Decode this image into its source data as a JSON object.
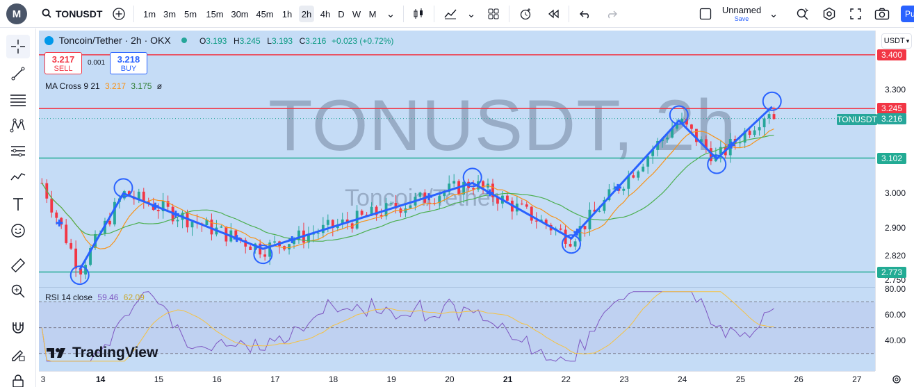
{
  "toolbar": {
    "symbol": "TONUSDT",
    "intervals": [
      "1m",
      "3m",
      "5m",
      "15m",
      "30m",
      "45m",
      "1h",
      "2h",
      "4h",
      "D",
      "W",
      "M"
    ],
    "active_interval": "2h",
    "layout_name": "Unnamed",
    "layout_status": "Save",
    "publish_label": "Pu"
  },
  "legend": {
    "title": "Toncoin/Tether · 2h · OKX",
    "open_label": "O",
    "open": "3.193",
    "high_label": "H",
    "high": "3.245",
    "low_label": "L",
    "low": "3.193",
    "close_label": "C",
    "close": "3.216",
    "change": "+0.023 (+0.72%)",
    "sell_price": "3.217",
    "sell_label": "SELL",
    "spread": "0.001",
    "buy_price": "3.218",
    "buy_label": "BUY",
    "ma_label": "MA Cross 9 21",
    "ma_fast": "3.217",
    "ma_slow": "3.175",
    "ma_symbol": "ø",
    "rsi_label": "RSI 14 close",
    "rsi_value": "59.46",
    "rsi_ma": "62.09"
  },
  "watermark": {
    "main": "TONUSDT, 2h",
    "sub": "Toncoin/Tether"
  },
  "branding": {
    "logo_text": "TradingView"
  },
  "price_axis": {
    "currency": "USDT",
    "ticks": [
      "3.300",
      "3.000",
      "2.900",
      "2.820",
      "2.750"
    ],
    "tags": [
      {
        "label": "3.400",
        "color": "#f23645"
      },
      {
        "label": "3.245",
        "color": "#f23645"
      },
      {
        "label": "3.216",
        "color": "#26a69a"
      },
      {
        "label": "3.102",
        "color": "#22ab94"
      },
      {
        "label": "2.773",
        "color": "#22ab94"
      }
    ],
    "symbol_tag": "TONUSDT",
    "rsi_ticks": [
      "80.00",
      "60.00",
      "40.00"
    ]
  },
  "time_axis": {
    "ticks": [
      "3",
      "14",
      "15",
      "16",
      "17",
      "18",
      "19",
      "20",
      "21",
      "22",
      "23",
      "24",
      "25",
      "26",
      "27"
    ],
    "bold": [
      "14",
      "21"
    ]
  },
  "colors": {
    "background": "#c5dcf6",
    "up": "#26a69a",
    "down": "#f23645",
    "resistance": "#f23645",
    "support": "#22ab94",
    "ma_fast": "#f7931a",
    "ma_slow": "#4caf50",
    "zigzag": "#2962ff",
    "rsi": "#7e57c2",
    "rsi_ma": "#f5c242"
  },
  "chart_data": {
    "type": "candlestick",
    "ylim": [
      2.73,
      3.47
    ],
    "horizontal_levels": [
      {
        "value": 3.4,
        "kind": "resistance"
      },
      {
        "value": 3.245,
        "kind": "resistance"
      },
      {
        "value": 3.102,
        "kind": "support"
      },
      {
        "value": 2.773,
        "kind": "support"
      }
    ],
    "zigzag_pivots": [
      {
        "x": 13.65,
        "y": 2.78
      },
      {
        "x": 14.4,
        "y": 3.0
      },
      {
        "x": 16.8,
        "y": 2.84
      },
      {
        "x": 20.4,
        "y": 3.03
      },
      {
        "x": 22.1,
        "y": 2.87
      },
      {
        "x": 23.95,
        "y": 3.21
      },
      {
        "x": 24.6,
        "y": 3.1
      },
      {
        "x": 25.55,
        "y": 3.25
      }
    ],
    "rsi_ylim": [
      20,
      80
    ],
    "rsi_bands": [
      70,
      50,
      30
    ]
  }
}
